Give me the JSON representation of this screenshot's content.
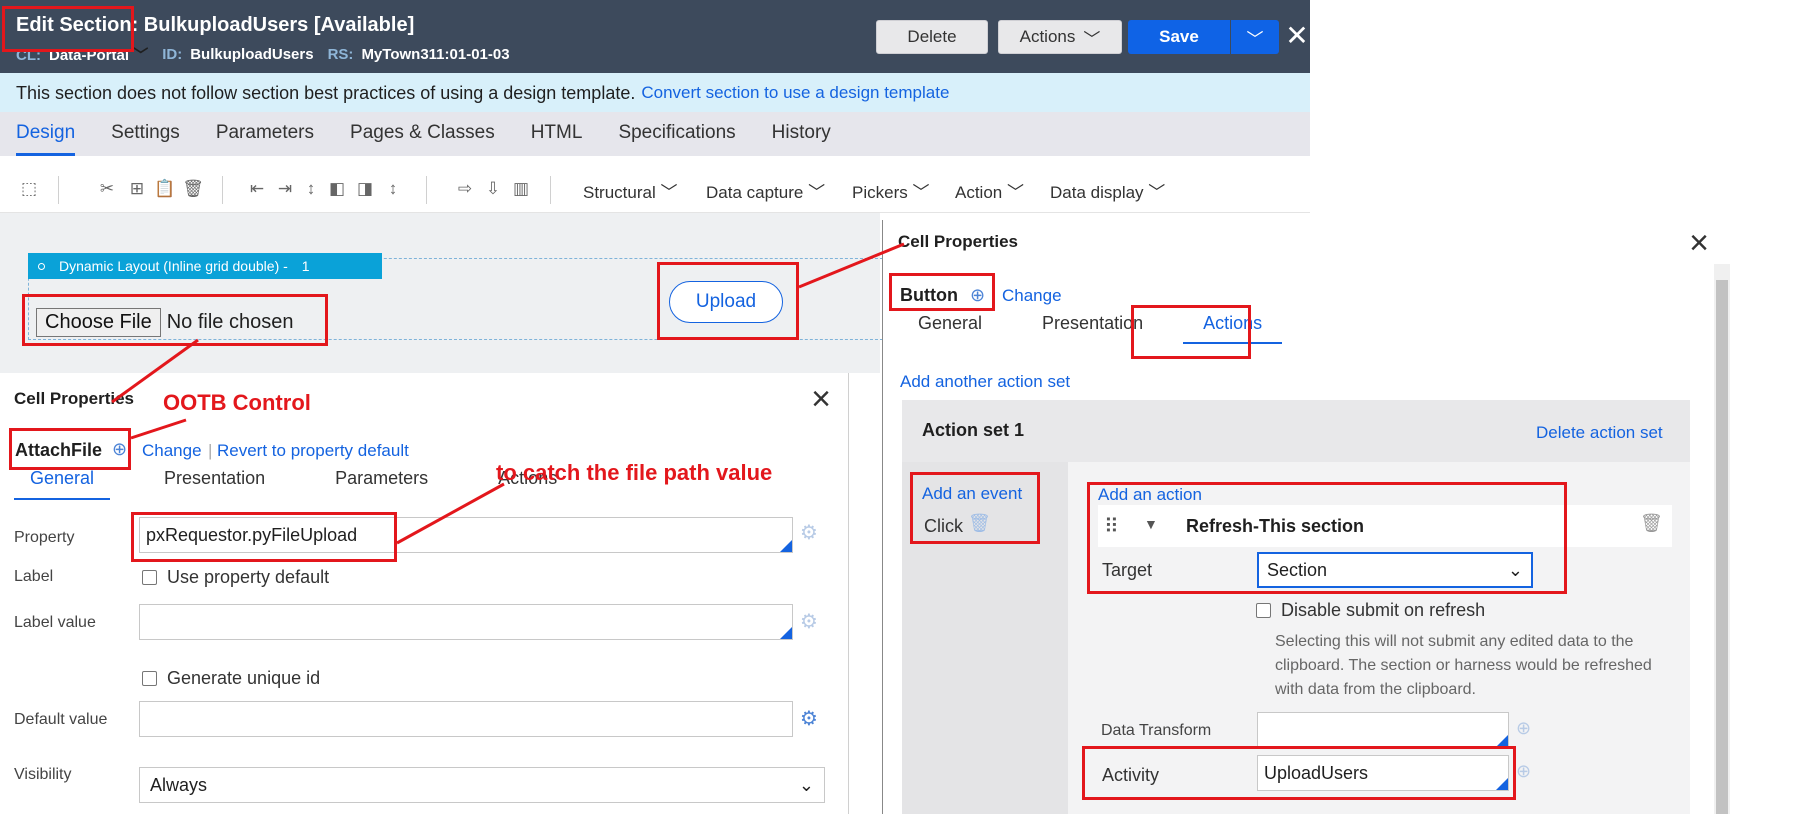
{
  "header": {
    "title_prefix": "Edit  Section:",
    "title_name": "BulkuploadUsers [Available]",
    "meta": [
      {
        "label": "CL:",
        "value": "Data-Portal"
      },
      {
        "label": "ID:",
        "value": "BulkuploadUsers"
      },
      {
        "label": "RS:",
        "value": "MyTown311:01-01-03"
      }
    ],
    "delete_label": "Delete",
    "actions_label": "Actions",
    "save_label": "Save"
  },
  "banner": {
    "text": "This section does not follow section best practices of using a design template.",
    "link": "Convert section to use a design template"
  },
  "tabs": [
    "Design",
    "Settings",
    "Parameters",
    "Pages & Classes",
    "HTML",
    "Specifications",
    "History"
  ],
  "toolbar": {
    "menus": [
      "Structural",
      "Data capture",
      "Pickers",
      "Action",
      "Data display"
    ]
  },
  "canvas": {
    "layout_label": "Dynamic Layout (Inline grid double) -",
    "layout_count": "1",
    "choose_file_label": "Choose File",
    "no_file_text": "No file chosen",
    "upload_label": "Upload"
  },
  "left_panel": {
    "title": "Cell Properties",
    "control": "AttachFile",
    "change": "Change",
    "revert": "Revert to property default",
    "tabs": [
      "General",
      "Presentation",
      "Parameters",
      "Actions"
    ],
    "property_label": "Property",
    "property_value": "pxRequestor.pyFileUpload",
    "label_label": "Label",
    "use_default": "Use property default",
    "label_value_label": "Label value",
    "generate_id": "Generate unique id",
    "default_value_label": "Default value",
    "visibility_label": "Visibility",
    "visibility_value": "Always"
  },
  "right_panel": {
    "title": "Cell Properties",
    "control": "Button",
    "change": "Change",
    "tabs": [
      "General",
      "Presentation",
      "Actions"
    ],
    "add_set": "Add another action set",
    "set_title": "Action set 1",
    "delete_set": "Delete action set",
    "add_event": "Add an event",
    "event": "Click",
    "add_action": "Add an action",
    "action_name": "Refresh-This section",
    "target_label": "Target",
    "target_value": "Section",
    "disable_submit": "Disable submit on refresh",
    "disable_help": "Selecting this will not submit any edited data to the clipboard. The section or harness would be refreshed with data from the clipboard.",
    "data_transform_label": "Data Transform",
    "activity_label": "Activity",
    "activity_value": "UploadUsers"
  },
  "annotations": {
    "ootb": "OOTB Control",
    "file_path": "to catch the file path value"
  },
  "colors": {
    "header_bg": "#3d4a5c",
    "accent": "#1463e0",
    "annotation_red": "#e3171c",
    "banner_bg": "#d8f0fa",
    "layout_label_bg": "#0aa2d8"
  }
}
